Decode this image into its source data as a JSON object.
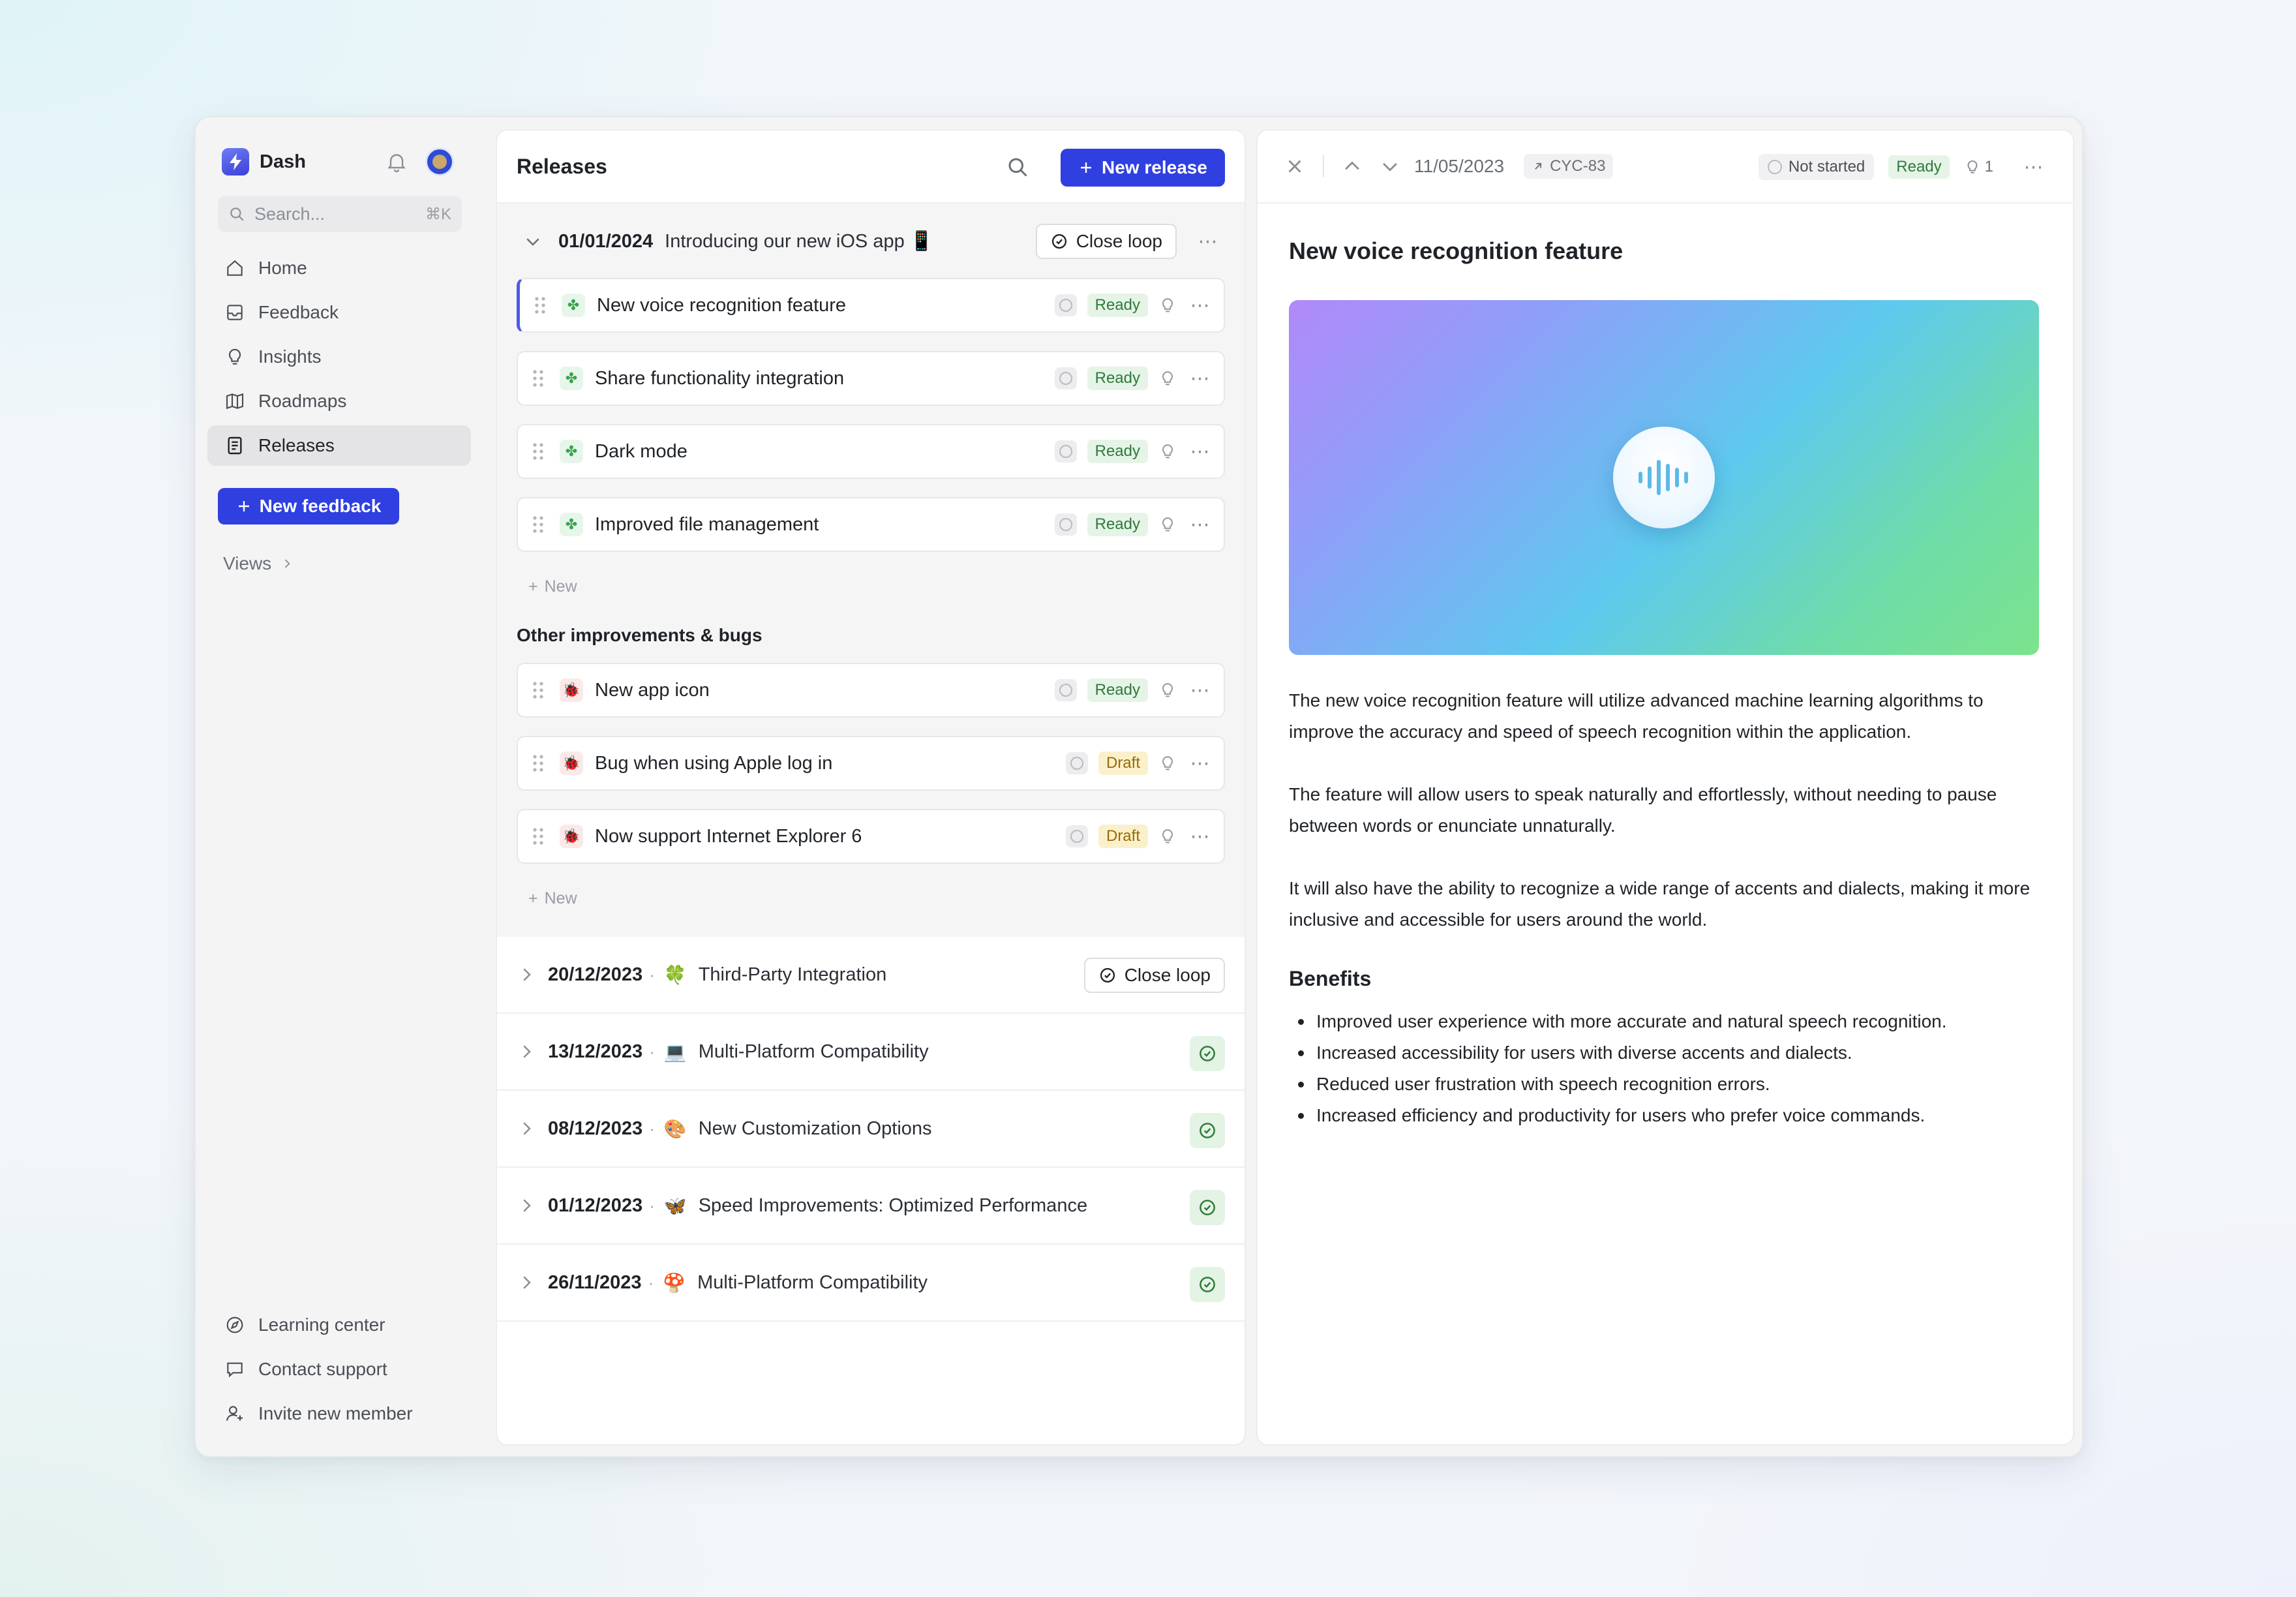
{
  "app": {
    "name": "Dash",
    "search_placeholder": "Search...",
    "search_shortcut": "⌘K"
  },
  "sidebar": {
    "items": [
      {
        "label": "Home",
        "icon": "home-icon"
      },
      {
        "label": "Feedback",
        "icon": "inbox-icon"
      },
      {
        "label": "Insights",
        "icon": "lightbulb-icon"
      },
      {
        "label": "Roadmaps",
        "icon": "map-icon"
      },
      {
        "label": "Releases",
        "icon": "document-icon",
        "active": true
      }
    ],
    "new_feedback_label": "New feedback",
    "views_label": "Views",
    "bottom_items": [
      {
        "label": "Learning center",
        "icon": "compass-icon"
      },
      {
        "label": "Contact support",
        "icon": "chat-icon"
      },
      {
        "label": "Invite new member",
        "icon": "user-plus-icon"
      }
    ]
  },
  "releases": {
    "title": "Releases",
    "new_release_label": "New release",
    "open_release": {
      "date": "01/01/2024",
      "name": "Introducing our new iOS app 📱",
      "close_loop_label": "Close loop",
      "features": [
        {
          "title": "New voice recognition feature",
          "status": "Ready",
          "selected": true
        },
        {
          "title": "Share functionality integration",
          "status": "Ready"
        },
        {
          "title": "Dark mode",
          "status": "Ready"
        },
        {
          "title": "Improved file management",
          "status": "Ready"
        }
      ],
      "add_new_label": "New",
      "section_label": "Other improvements & bugs",
      "bugs": [
        {
          "title": "New app icon",
          "status": "Ready"
        },
        {
          "title": "Bug when using Apple log in",
          "status": "Draft"
        },
        {
          "title": "Now support Internet Explorer 6",
          "status": "Draft"
        }
      ],
      "add_new_label_2": "New"
    },
    "other_releases": [
      {
        "date": "20/12/2023",
        "emoji": "🍀",
        "name": "Third-Party Integration",
        "action": "Close loop"
      },
      {
        "date": "13/12/2023",
        "emoji": "💻",
        "name": "Multi-Platform Compatibility",
        "done": true
      },
      {
        "date": "08/12/2023",
        "emoji": "🎨",
        "name": "New Customization Options",
        "done": true
      },
      {
        "date": "01/12/2023",
        "emoji": "🦋",
        "name": "Speed Improvements: Optimized Performance",
        "done": true
      },
      {
        "date": "26/11/2023",
        "emoji": "🍄",
        "name": "Multi-Platform Compatibility",
        "done": true
      }
    ]
  },
  "detail": {
    "date": "11/05/2023",
    "id": "CYC-83",
    "status_label": "Not started",
    "ready_label": "Ready",
    "insight_count": "1",
    "title": "New voice recognition feature",
    "paragraphs": [
      "The new voice recognition feature will utilize advanced machine learning algorithms to improve the accuracy and speed of speech recognition within the application.",
      "The feature will allow users to speak naturally and effortlessly, without needing to pause between words or enunciate unnaturally.",
      "It will also have the ability to recognize a wide range of accents and dialects, making it more inclusive and accessible for users around the world."
    ],
    "benefits_heading": "Benefits",
    "benefits": [
      "Improved user experience with more accurate and natural speech recognition.",
      "Increased accessibility for users with diverse accents and dialects.",
      "Reduced user frustration with speech recognition errors.",
      "Increased efficiency and productivity for users who prefer voice commands."
    ]
  },
  "colors": {
    "accent": "#2f3fe0",
    "ready_bg": "#e6f4e7",
    "draft_bg": "#fbf0cc"
  }
}
